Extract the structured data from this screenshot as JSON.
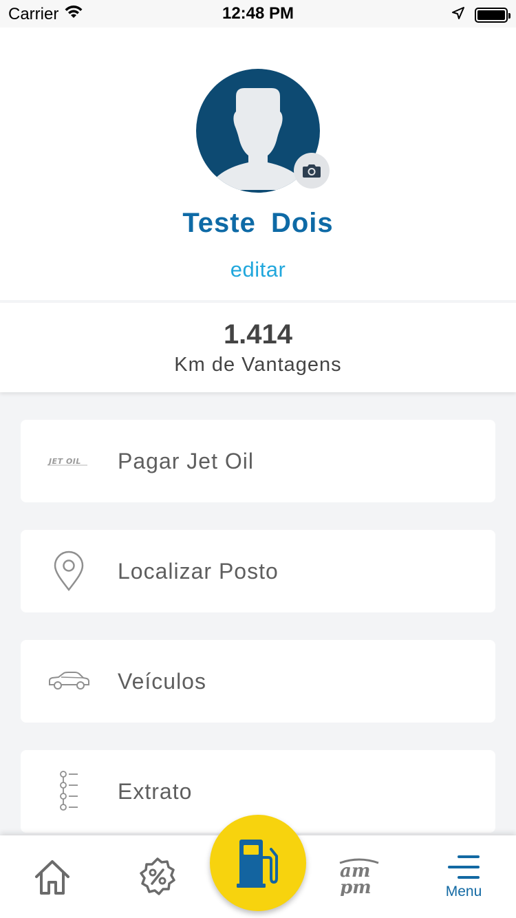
{
  "status_bar": {
    "carrier": "Carrier",
    "time": "12:48 PM"
  },
  "profile": {
    "name": "Teste  Dois",
    "edit_label": "editar"
  },
  "points": {
    "value": "1.414",
    "label": "Km de Vantagens"
  },
  "menu": {
    "items": [
      {
        "label": "Pagar Jet Oil",
        "icon": "jet-oil-logo-icon"
      },
      {
        "label": "Localizar Posto",
        "icon": "location-pin-icon"
      },
      {
        "label": "Veículos",
        "icon": "car-icon"
      },
      {
        "label": "Extrato",
        "icon": "statement-list-icon"
      }
    ]
  },
  "tab_bar": {
    "tabs": [
      {
        "icon": "home-icon"
      },
      {
        "icon": "discount-badge-icon"
      },
      {
        "icon": "fuel-pump-icon"
      },
      {
        "icon": "ampm-logo-icon"
      },
      {
        "icon": "menu-lines-icon",
        "label": "Menu"
      }
    ]
  },
  "colors": {
    "brand_blue": "#0e6aa6",
    "link_cyan": "#21a7dc",
    "avatar_bg": "#0d4a72",
    "fab_yellow": "#f7d30e",
    "background": "#f3f4f6"
  }
}
